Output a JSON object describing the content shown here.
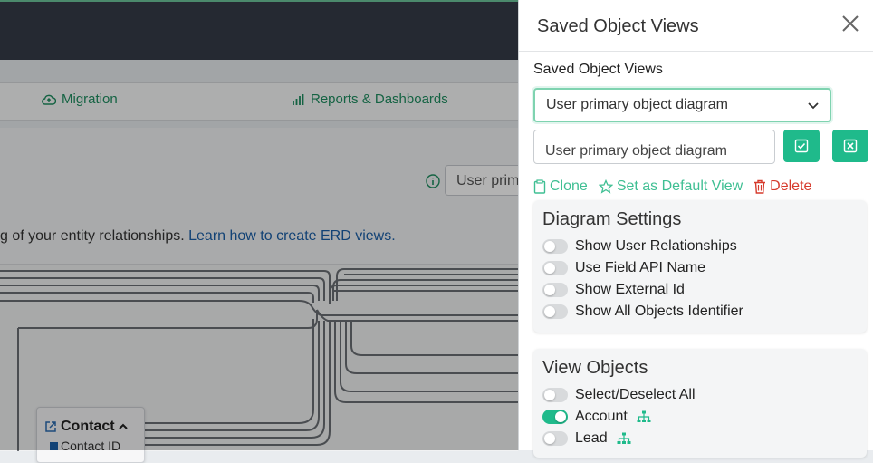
{
  "nav": {
    "migration": "Migration",
    "reports": "Reports & Dashboards"
  },
  "background": {
    "view_select_value": "User prim",
    "description_text": "g of your entity relationships.",
    "description_link": "Learn how to create ERD views.",
    "node": {
      "title": "Contact",
      "field": "Contact ID"
    }
  },
  "panel": {
    "title": "Saved Object Views",
    "label": "Saved Object Views",
    "selected_view": "User primary object diagram",
    "name_value": "User primary object diagram",
    "actions": {
      "clone": "Clone",
      "set_default": "Set as Default View",
      "delete": "Delete"
    },
    "diagram_settings": {
      "title": "Diagram Settings",
      "items": [
        {
          "label": "Show User Relationships",
          "on": false
        },
        {
          "label": "Use Field API Name",
          "on": false
        },
        {
          "label": "Show External Id",
          "on": false
        },
        {
          "label": "Show All Objects Identifier",
          "on": false
        }
      ]
    },
    "view_objects": {
      "title": "View Objects",
      "items": [
        {
          "label": "Select/Deselect All",
          "on": false
        },
        {
          "label": "Account",
          "on": true
        },
        {
          "label": "Lead",
          "on": false
        }
      ]
    }
  },
  "colors": {
    "accent": "#1fba8b",
    "danger": "#d63a2c",
    "topbar": "#353c48"
  }
}
